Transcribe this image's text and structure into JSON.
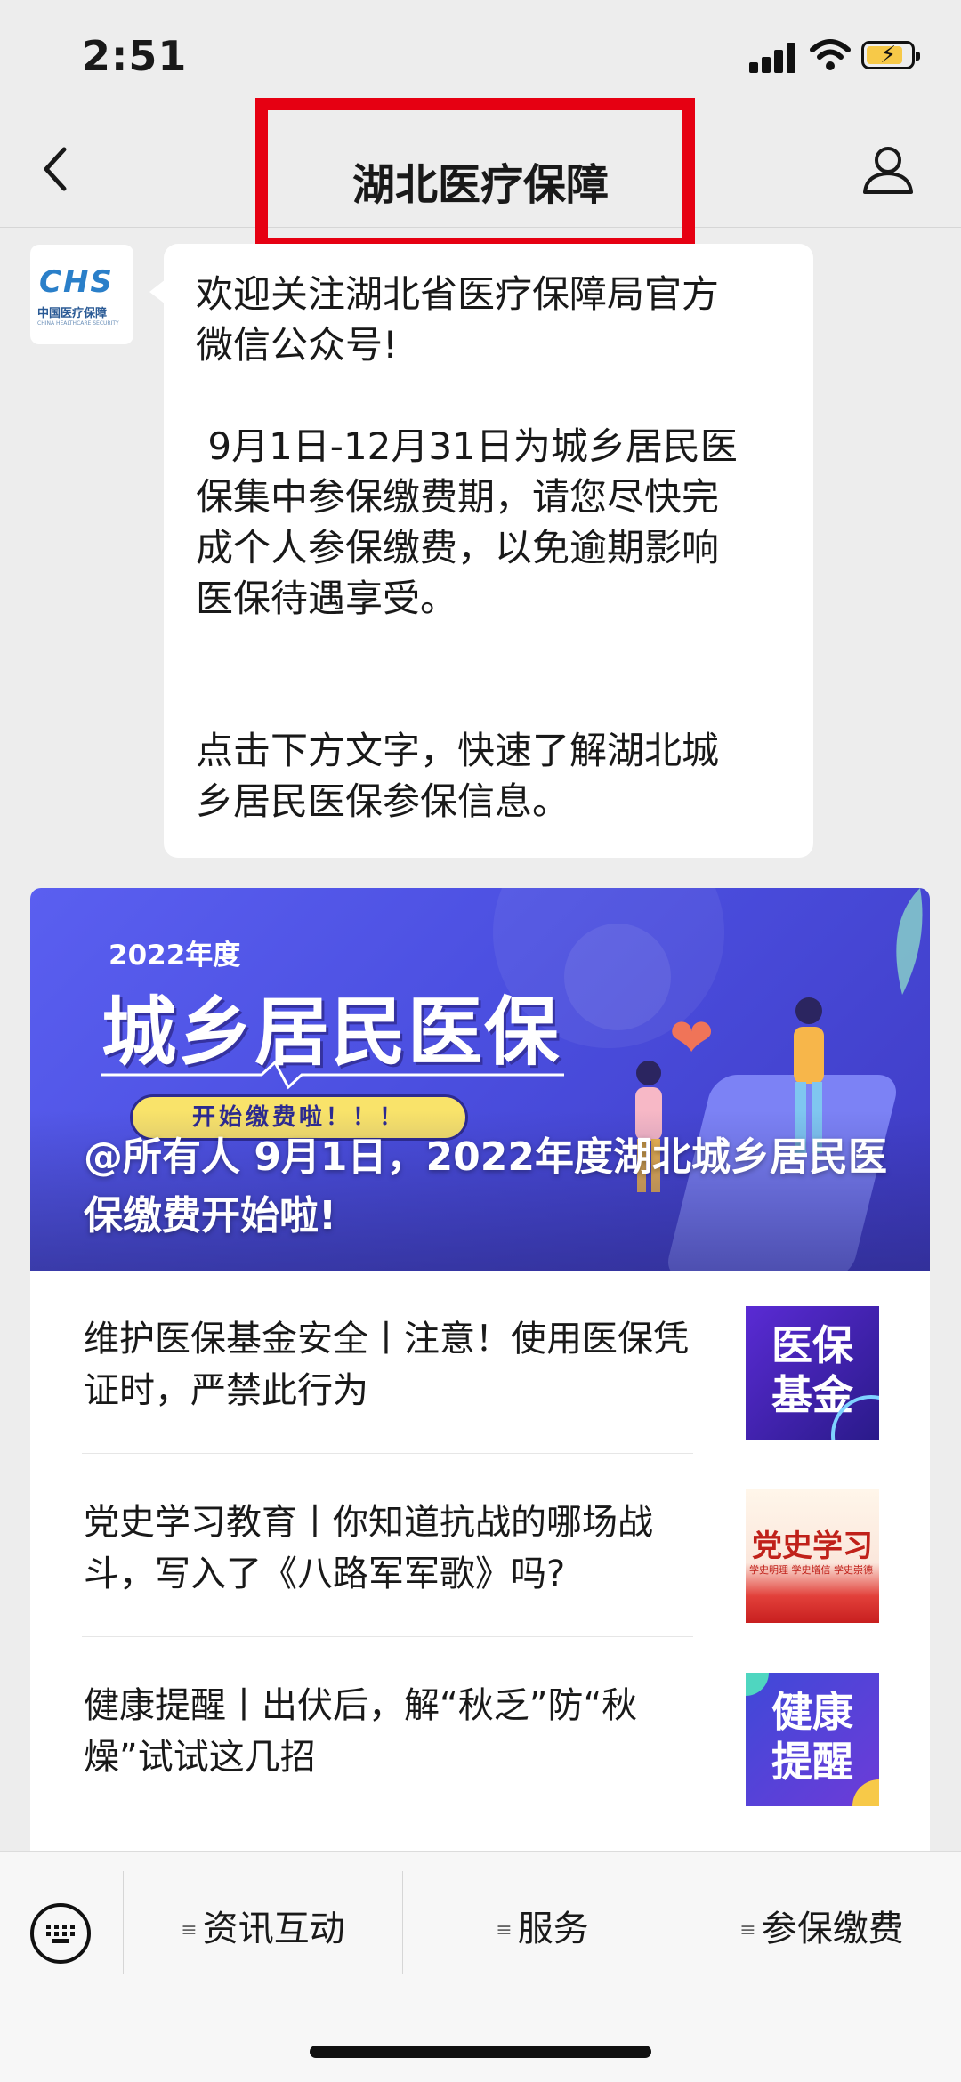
{
  "status_bar": {
    "time": "2:51"
  },
  "nav": {
    "title": "湖北医疗保障"
  },
  "account": {
    "logo_text": "CHS",
    "logo_cn": "中国医疗保障",
    "logo_en": "CHINA HEALTHCARE SECURITY"
  },
  "message": {
    "line1": "欢迎关注湖北省医疗保障局官方\n微信公众号!",
    "line2": " 9月1日-12月31日为城乡居民医\n保集中参保缴费期，请您尽快完\n成个人参保缴费，以免逾期影响\n医保待遇享受。",
    "line3": "点击下方文字，快速了解湖北城\n乡居民医保参保信息。"
  },
  "banner": {
    "year_label": "2022年度",
    "headline": "城乡居民医保",
    "pill": "开始缴费啦！！！",
    "caption": "@所有人 9月1日，2022年度湖北城乡居民医保缴费开始啦!"
  },
  "articles": [
    {
      "title": "维护医保基金安全丨注意！使用医保凭证时，严禁此行为",
      "thumb_text": "医保\n基金",
      "thumb_icon": "yibao-jijin-thumbnail"
    },
    {
      "title": "党史学习教育丨你知道抗战的哪场战斗，写入了《八路军军歌》吗?",
      "thumb_text": "党史学习",
      "thumb_sub": "学史明理 学史增信 学史崇德",
      "thumb_icon": "dangshi-thumbnail"
    },
    {
      "title": "健康提醒丨出伏后，解“秋乏”防“秋燥”试试这几招",
      "thumb_text": "健康\n提醒",
      "thumb_icon": "jiankang-thumbnail"
    }
  ],
  "menu": {
    "items": [
      "资讯互动",
      "服务",
      "参保缴费"
    ]
  },
  "colors": {
    "highlight_box": "#e60012",
    "banner_bg": "#4b4fe0",
    "page_bg": "#ededed"
  }
}
